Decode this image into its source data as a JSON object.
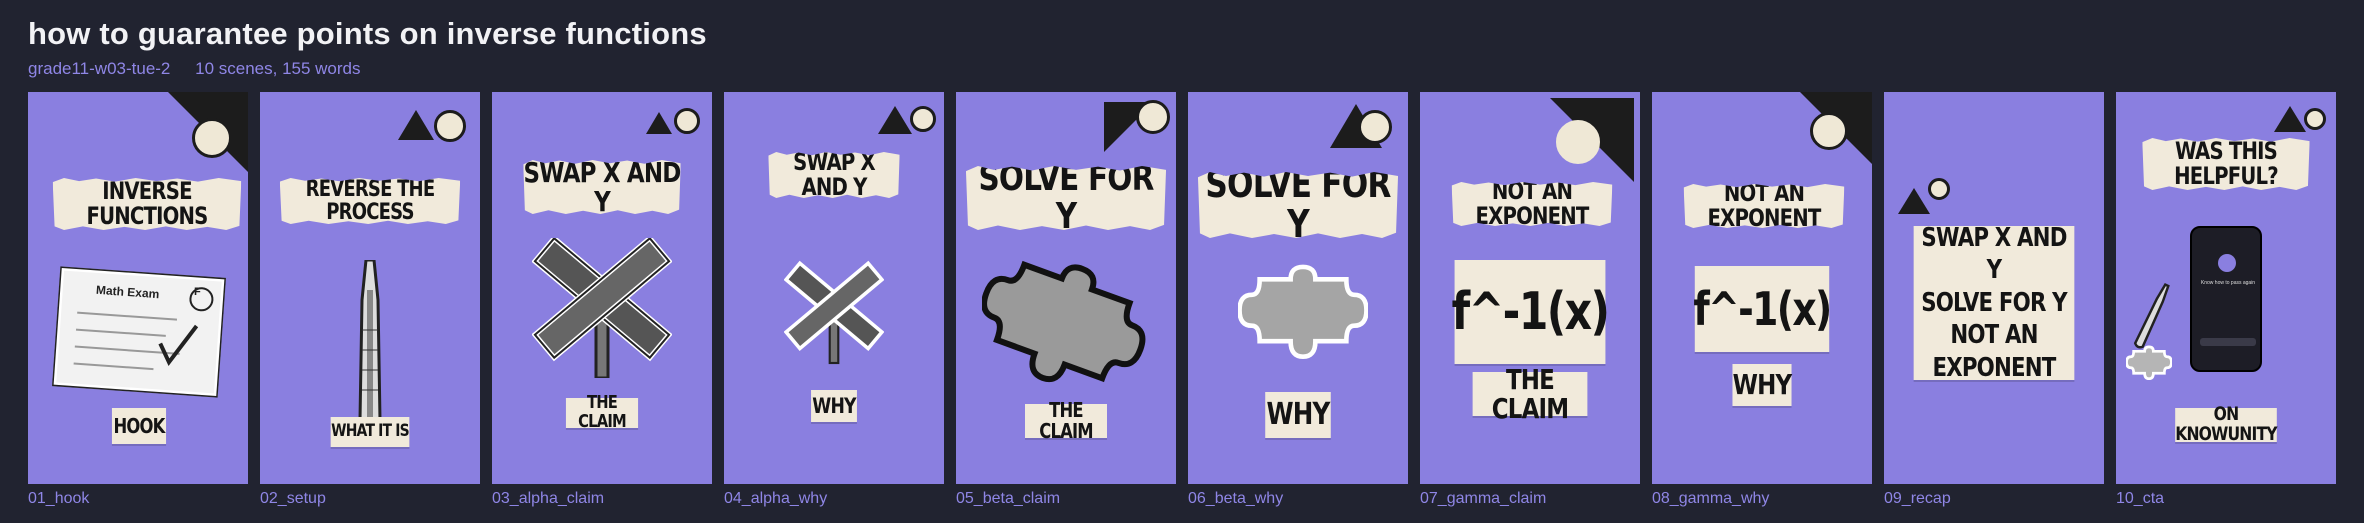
{
  "header": {
    "title": "how to guarantee points on inverse functions",
    "lesson_id": "grade11-w03-tue-2",
    "summary": "10 scenes, 155 words"
  },
  "colors": {
    "background": "#212330",
    "scene_bg": "#8a7fe0",
    "label": "#8f86e6",
    "paper": "#f1eadb"
  },
  "scenes": [
    {
      "id": "01_hook",
      "headline": "INVERSE FUNCTIONS",
      "caption": "HOOK",
      "prop_icon": "math-exam-paper-icon",
      "prop_title": "Math Exam",
      "prop_grade": "F"
    },
    {
      "id": "02_setup",
      "headline": "REVERSE THE PROCESS",
      "caption": "WHAT IT IS",
      "prop_icon": "thermometer-icon"
    },
    {
      "id": "03_alpha_claim",
      "headline": "SWAP X AND Y",
      "caption": "THE CLAIM",
      "prop_icon": "crossed-street-signs-icon"
    },
    {
      "id": "04_alpha_why",
      "headline": "SWAP X AND Y",
      "caption": "WHY",
      "prop_icon": "crossed-street-signs-icon"
    },
    {
      "id": "05_beta_claim",
      "headline": "SOLVE FOR Y",
      "caption": "THE CLAIM",
      "prop_icon": "puzzle-piece-icon"
    },
    {
      "id": "06_beta_why",
      "headline": "SOLVE FOR Y",
      "caption": "WHY",
      "prop_icon": "puzzle-piece-icon"
    },
    {
      "id": "07_gamma_claim",
      "headline": "NOT AN EXPONENT",
      "caption": "THE CLAIM",
      "formula": "f^-1(x)"
    },
    {
      "id": "08_gamma_why",
      "headline": "NOT AN EXPONENT",
      "caption": "WHY",
      "formula": "f^-1(x)"
    },
    {
      "id": "09_recap",
      "headline": "",
      "caption": "",
      "recap_lines": [
        "SWAP X AND Y",
        "SOLVE FOR Y",
        "NOT AN EXPONENT"
      ]
    },
    {
      "id": "10_cta",
      "headline": "WAS THIS HELPFUL?",
      "caption": "ON KNOWUNITY",
      "prop_icon": "phone-app-icon",
      "phone_text": "Know how to pass again"
    }
  ]
}
